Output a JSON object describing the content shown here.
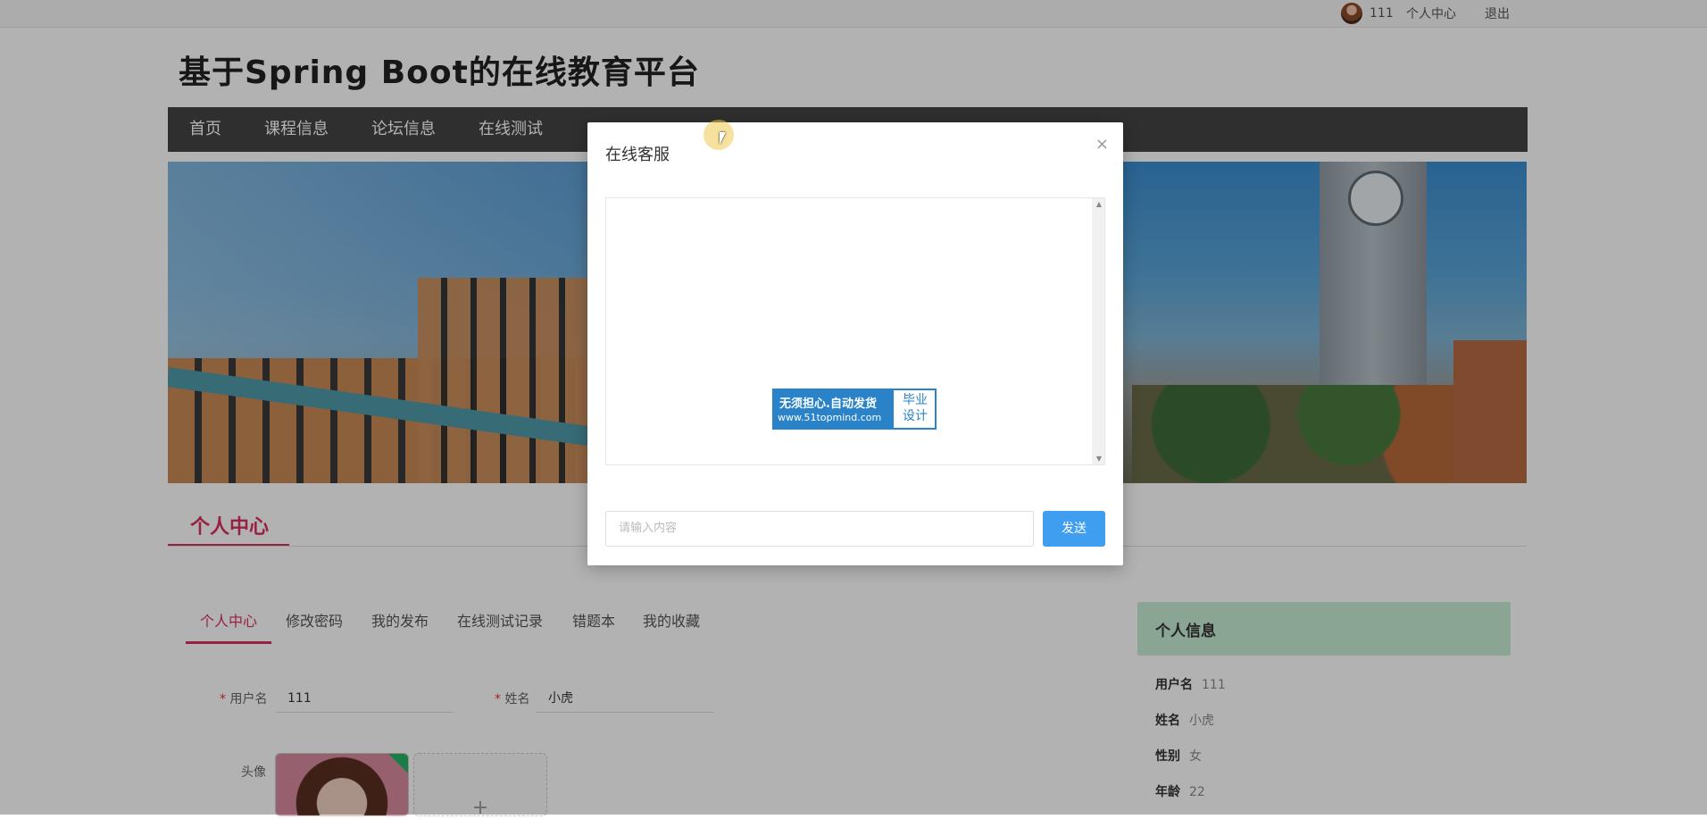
{
  "topbar": {
    "username": "111",
    "personal_center": "个人中心",
    "logout": "退出"
  },
  "site": {
    "title": "基于Spring Boot的在线教育平台"
  },
  "nav": {
    "items": [
      {
        "label": "首页"
      },
      {
        "label": "课程信息"
      },
      {
        "label": "论坛信息"
      },
      {
        "label": "在线测试"
      }
    ]
  },
  "section": {
    "title": "个人中心"
  },
  "subtabs": {
    "items": [
      {
        "label": "个人中心",
        "active": true
      },
      {
        "label": "修改密码"
      },
      {
        "label": "我的发布"
      },
      {
        "label": "在线测试记录"
      },
      {
        "label": "错题本"
      },
      {
        "label": "我的收藏"
      }
    ]
  },
  "form": {
    "username_label": "用户名",
    "username_value": "111",
    "name_label": "姓名",
    "name_value": "小虎",
    "avatar_label": "头像",
    "required_mark": "*",
    "upload_icon": "+"
  },
  "info_card": {
    "title": "个人信息",
    "rows": [
      {
        "key": "用户名",
        "value": "111"
      },
      {
        "key": "姓名",
        "value": "小虎"
      },
      {
        "key": "性别",
        "value": "女"
      },
      {
        "key": "年龄",
        "value": "22"
      }
    ]
  },
  "dialog": {
    "title": "在线客服",
    "close_icon": "×",
    "input_placeholder": "请输入内容",
    "send_label": "发送",
    "scroll_up": "▲",
    "scroll_down": "▼",
    "watermark_line1": "无须担心.自动发货",
    "watermark_line2": "www.51topmind.com",
    "watermark_right": "毕业设计"
  },
  "colors": {
    "accent": "#d9305e",
    "nav_bg": "#444444",
    "send_button": "#3f9ef0",
    "info_card_bg": "#c8ecd6"
  }
}
